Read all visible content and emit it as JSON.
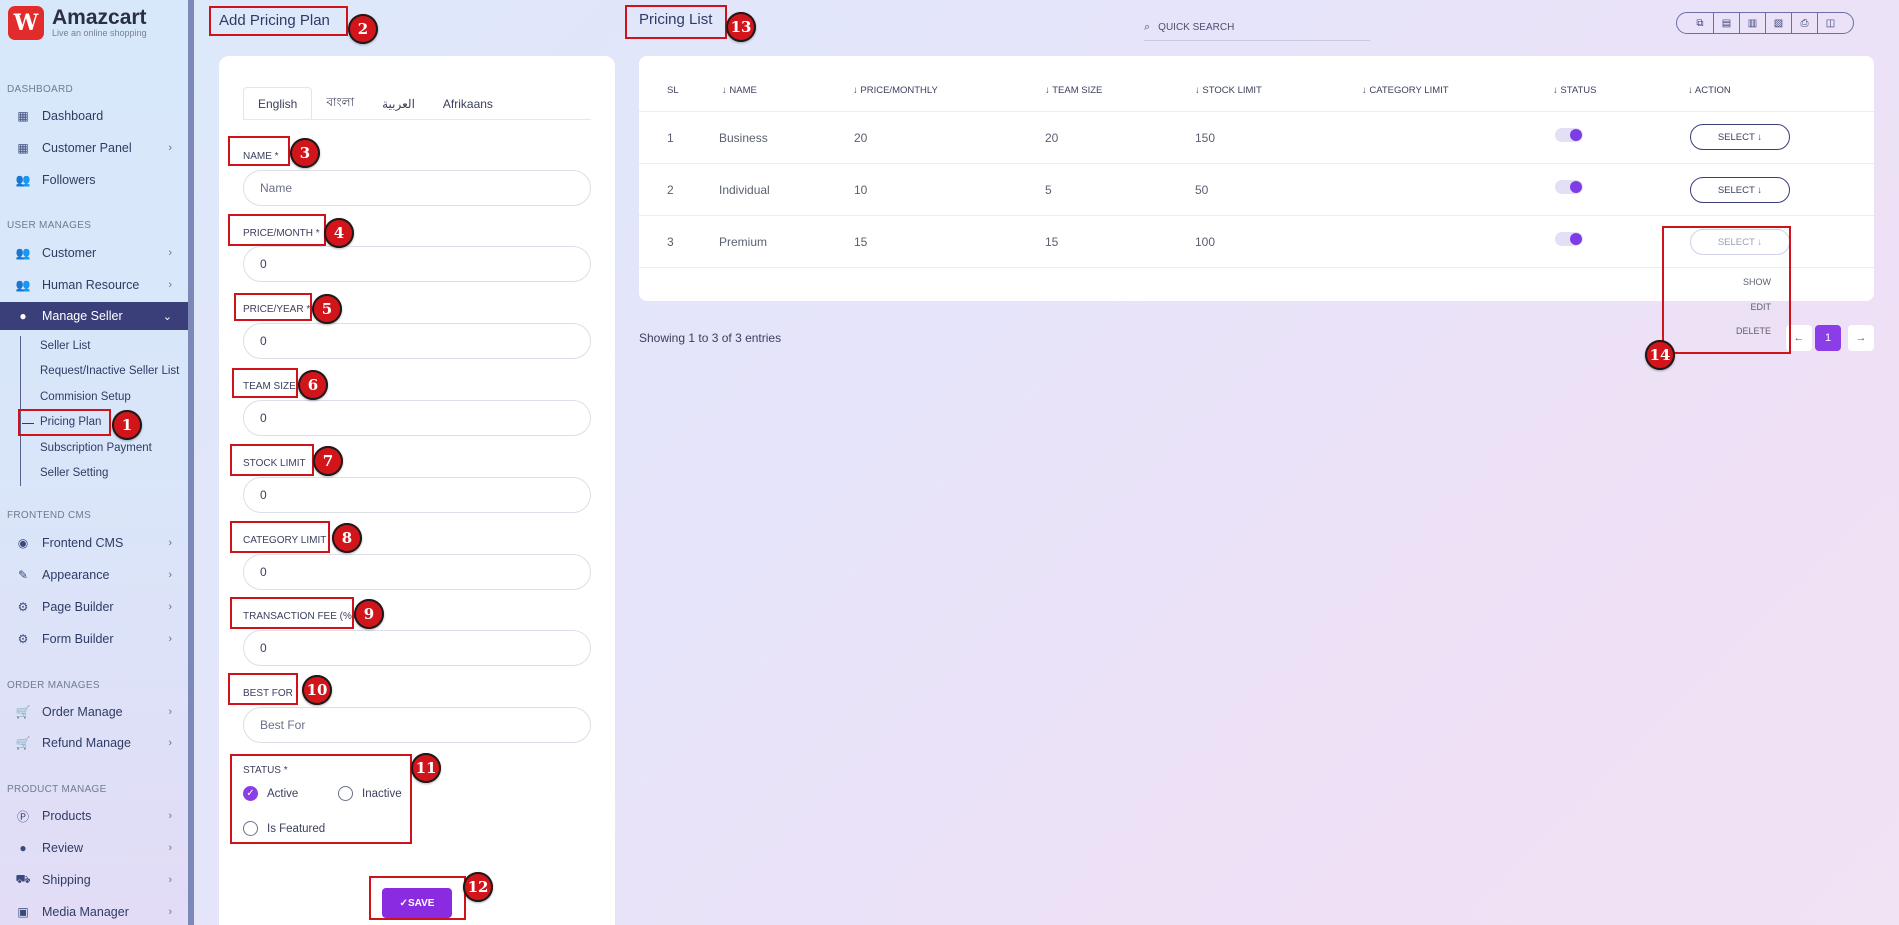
{
  "brand": {
    "title": "Amazcart",
    "tagline": "Live an online shopping",
    "logo_icon": "logo-icon"
  },
  "sidebar": {
    "sections": {
      "dashboard": "DASHBOARD",
      "user_manages": "USER MANAGES",
      "frontend_cms": "FRONTEND CMS",
      "order_manages": "ORDER MANAGES",
      "product_manage": "PRODUCT MANAGE"
    },
    "items": {
      "dashboard": "Dashboard",
      "customer_panel": "Customer Panel",
      "followers": "Followers",
      "customer": "Customer",
      "human_resource": "Human Resource",
      "manage_seller": "Manage Seller",
      "frontend_cms": "Frontend CMS",
      "appearance": "Appearance",
      "page_builder": "Page Builder",
      "form_builder": "Form Builder",
      "order_manage": "Order Manage",
      "refund_manage": "Refund Manage",
      "products": "Products",
      "review": "Review",
      "shipping": "Shipping",
      "media_manager": "Media Manager"
    },
    "manage_seller_sub": {
      "seller_list": "Seller List",
      "request_inactive": "Request/Inactive Seller List",
      "commision_setup": "Commision Setup",
      "pricing_plan": "Pricing Plan",
      "subscription_payment": "Subscription Payment",
      "seller_setting": "Seller Setting"
    }
  },
  "form": {
    "title": "Add Pricing Plan",
    "tabs": [
      "English",
      "বাংলা",
      "العربية",
      "Afrikaans"
    ],
    "fields": {
      "name": {
        "label": "NAME *",
        "placeholder": "Name",
        "value": ""
      },
      "price_month": {
        "label": "PRICE/MONTH *",
        "value": "0"
      },
      "price_year": {
        "label": "PRICE/YEAR *",
        "value": "0"
      },
      "team_size": {
        "label": "TEAM SIZE",
        "value": "0"
      },
      "stock_limit": {
        "label": "STOCK LIMIT",
        "value": "0"
      },
      "category_limit": {
        "label": "CATEGORY LIMIT",
        "value": "0"
      },
      "transaction_fee": {
        "label": "TRANSACTION FEE (%)",
        "value": "0"
      },
      "best_for": {
        "label": "BEST FOR",
        "placeholder": "Best For",
        "value": ""
      }
    },
    "status": {
      "label": "STATUS *",
      "options": {
        "active": "Active",
        "inactive": "Inactive",
        "featured": "Is Featured"
      },
      "selected": "active"
    },
    "save_label": "SAVE"
  },
  "list": {
    "title": "Pricing List",
    "search_placeholder": "QUICK SEARCH",
    "toolbar_icons": [
      "copy-icon",
      "csv-icon",
      "excel-icon",
      "pdf-icon",
      "print-icon",
      "columns-icon"
    ],
    "columns": {
      "sl": "SL",
      "name": "NAME",
      "price": "PRICE/MONTHLY",
      "team": "TEAM SIZE",
      "stock": "STOCK LIMIT",
      "category": "CATEGORY LIMIT",
      "status": "STATUS",
      "action": "ACTION"
    },
    "rows": [
      {
        "sl": "1",
        "name": "Business",
        "price": "20",
        "team": "20",
        "stock": "150",
        "category": "",
        "status_on": true,
        "action": "SELECT"
      },
      {
        "sl": "2",
        "name": "Individual",
        "price": "10",
        "team": "5",
        "stock": "50",
        "category": "",
        "status_on": true,
        "action": "SELECT"
      },
      {
        "sl": "3",
        "name": "Premium",
        "price": "15",
        "team": "15",
        "stock": "100",
        "category": "",
        "status_on": true,
        "action": "SELECT"
      }
    ],
    "dropdown": {
      "show": "SHOW",
      "edit": "EDIT",
      "delete": "DELETE"
    },
    "showing_text": "Showing 1 to 3 of 3 entries",
    "pagination": {
      "current": "1"
    }
  },
  "annotations": [
    "1",
    "2",
    "3",
    "4",
    "5",
    "6",
    "7",
    "8",
    "9",
    "10",
    "11",
    "12",
    "13",
    "14"
  ]
}
